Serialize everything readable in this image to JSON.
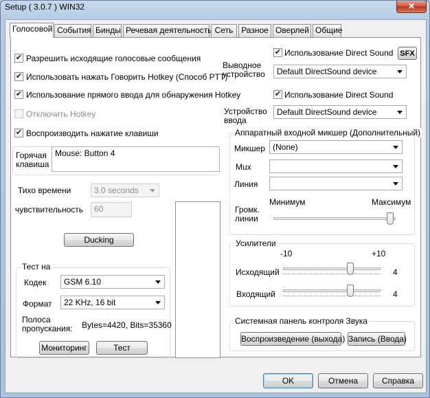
{
  "window": {
    "title": "Setup ( 3.0.7 ) WIN32",
    "close_glyph": "✕"
  },
  "tabs": [
    {
      "label": "Голосовой",
      "active": true
    },
    {
      "label": "События"
    },
    {
      "label": "Бинды"
    },
    {
      "label": "Речевая деятельность"
    },
    {
      "label": "Сеть"
    },
    {
      "label": "Разное"
    },
    {
      "label": "Оверлей"
    },
    {
      "label": "Общие"
    }
  ],
  "voice": {
    "checkboxes": [
      {
        "label": "Разрешить исходящие голосовые сообщения",
        "checked": true,
        "enabled": true
      },
      {
        "label": "Использовать нажать Говорить Hotkey (Способ PTT)",
        "checked": true,
        "enabled": true
      },
      {
        "label": "Использование прямого ввода для обнаружения Hotkey",
        "checked": true,
        "enabled": true
      },
      {
        "label": "Отключить Hotkey",
        "checked": false,
        "enabled": false
      },
      {
        "label": "Воспроизводить нажатие клавиши",
        "checked": true,
        "enabled": true
      }
    ],
    "hotkey_label": "Горячая клавиша",
    "hotkey_value": "Mouse: Button 4",
    "quiet_time_label": "Тихо времени",
    "quiet_time_value": "3.0 seconds",
    "sensitivity_label": "чувствительность",
    "sensitivity_value": "60",
    "ducking_button": "Ducking"
  },
  "test": {
    "group_title": "Тест на",
    "codec_label": "Кодек",
    "codec_value": "GSM 6.10",
    "format_label": "Формат",
    "format_value": "22 KHz, 16 bit",
    "bandwidth_label": "Полоса пропускания:",
    "bandwidth_value": "Bytes=4420, Bits=35360",
    "monitoring_button": "Мониторинг",
    "test_button": "Тест"
  },
  "output": {
    "direct_sound_label": "Использование Direct Sound",
    "direct_sound_checked": true,
    "sfx_button": "SFX",
    "device_label": "Выводное устройство",
    "device_value": "Default DirectSound device"
  },
  "input": {
    "direct_sound_label": "Использование Direct Sound",
    "direct_sound_checked": true,
    "device_label": "Устройство ввода",
    "device_value": "Default DirectSound device"
  },
  "mixer": {
    "group_title": "Аппаратный входной микшер (Дополнительный)",
    "mixer_label": "Микшер",
    "mixer_value": "(None)",
    "mux_label": "Мux",
    "mux_value": "",
    "line_label": "Линия",
    "line_value": "",
    "min_label": "Минимум",
    "max_label": "Максимум",
    "volume_label": "Громк. линии",
    "volume_level": 1.0
  },
  "amps": {
    "group_title": "Усилители",
    "min_label": "-10",
    "max_label": "+10",
    "outgoing_label": "Исходящий",
    "outgoing_value": "4",
    "incoming_label": "Входящий",
    "incoming_value": "4"
  },
  "sound_panel": {
    "group_title": "Системная панель контроля Звука",
    "playback_button": "Воспроизведение (выхода)",
    "record_button": "Запись (Ввода)"
  },
  "footer": {
    "ok": "OK",
    "cancel": "Отмена",
    "help": "Справка"
  },
  "glyphs": {
    "check": "✔"
  }
}
